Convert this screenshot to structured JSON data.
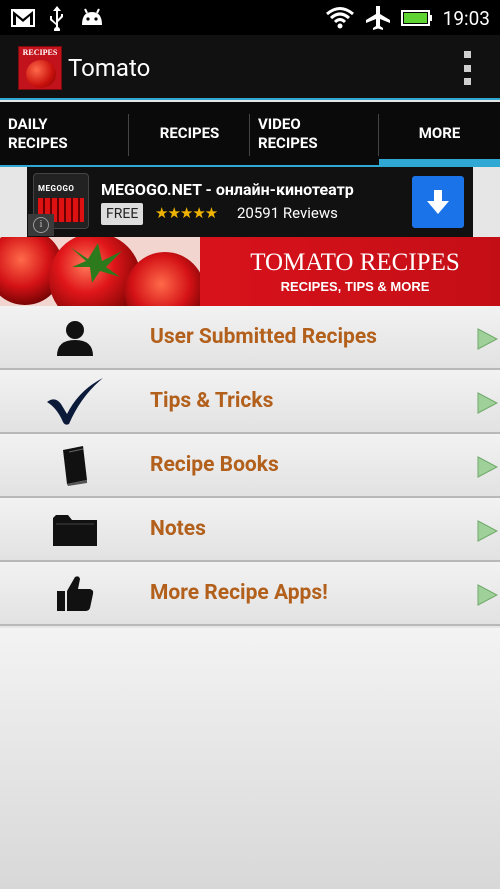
{
  "status_bar": {
    "time": "19:03"
  },
  "action_bar": {
    "app_icon_text": "RECIPES",
    "title": "Tomato"
  },
  "tabs": [
    {
      "line1": "DAILY",
      "line2": "RECIPES",
      "active": false
    },
    {
      "line1": "RECIPES",
      "line2": "",
      "active": false
    },
    {
      "line1": "VIDEO",
      "line2": "RECIPES",
      "active": false
    },
    {
      "line1": "MORE",
      "line2": "",
      "active": true
    }
  ],
  "ad": {
    "logo_text": "MEGOGO",
    "title": "MEGOGO.NET - онлайн-кинотеатр",
    "price": "FREE",
    "rating": 4.5,
    "stars": "★★★★★",
    "reviews": "20591 Reviews",
    "info_glyph": "i"
  },
  "banner": {
    "title": "TOMATO RECIPES",
    "subtitle": "RECIPES, TIPS & MORE"
  },
  "menu": [
    {
      "label": "User Submitted Recipes",
      "icon": "person-icon"
    },
    {
      "label": "Tips & Tricks",
      "icon": "checkmark-icon"
    },
    {
      "label": "Recipe Books",
      "icon": "book-icon"
    },
    {
      "label": "Notes",
      "icon": "folder-icon"
    },
    {
      "label": "More Recipe Apps!",
      "icon": "thumbs-up-icon"
    }
  ],
  "colors": {
    "accent": "#2fa8d4",
    "menu_text": "#b2601b",
    "banner": "#d8121b"
  }
}
